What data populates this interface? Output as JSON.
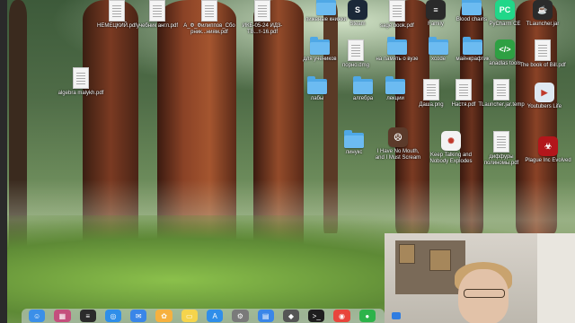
{
  "desktop_icons": [
    {
      "id": "nemetsky",
      "label": "НЕМЕЦКИЙ.pdf",
      "kind": "doc"
    },
    {
      "id": "uchebnik",
      "label": "учебник англ.pdf",
      "kind": "doc"
    },
    {
      "id": "filippov",
      "label": "А_Ф_Филиппов_Сборник...ниям.pdf",
      "kind": "doc"
    },
    {
      "id": "ikb",
      "label": "ИКБ-05-24 ИД3-ТВ...т-16.pdf",
      "kind": "doc"
    },
    {
      "id": "pizh",
      "label": "пиженые книжки",
      "kind": "folder"
    },
    {
      "id": "steam",
      "label": "Steam",
      "kind": "app",
      "color": "#1b2838",
      "glyph": "S"
    },
    {
      "id": "sage",
      "label": "sage book.pdf",
      "kind": "doc"
    },
    {
      "id": "family",
      "label": "Family",
      "kind": "app",
      "color": "#2a2a2a",
      "glyph": "≡"
    },
    {
      "id": "blood",
      "label": "Blood chains",
      "kind": "folder"
    },
    {
      "id": "pycharm",
      "label": "PyCharm CE",
      "kind": "app",
      "color": "#21d789",
      "glyph": "PC"
    },
    {
      "id": "tlauncher",
      "label": "TLauncher.jar",
      "kind": "app",
      "color": "#2b2b2b",
      "glyph": "☕"
    },
    {
      "id": "algebra_m",
      "label": "algebra malykh.pdf",
      "kind": "doc"
    },
    {
      "id": "uchenik",
      "label": "для учеников",
      "kind": "folder"
    },
    {
      "id": "porno",
      "label": "порно.dmg",
      "kind": "doc"
    },
    {
      "id": "navuz",
      "label": "на память о вузе",
      "kind": "folder"
    },
    {
      "id": "xcode",
      "label": "xcode",
      "kind": "folder"
    },
    {
      "id": "maynkraftik",
      "label": "майнкрафтик",
      "kind": "folder"
    },
    {
      "id": "anadlas",
      "label": "anadlas tools",
      "kind": "app",
      "color": "#2ea043",
      "glyph": "</>"
    },
    {
      "id": "billbook",
      "label": "The book of Bill.pdf",
      "kind": "doc"
    },
    {
      "id": "laby",
      "label": "лабы",
      "kind": "folder"
    },
    {
      "id": "algebra",
      "label": "алгебра",
      "kind": "folder"
    },
    {
      "id": "lekcii",
      "label": "лекции",
      "kind": "folder"
    },
    {
      "id": "dasha",
      "label": "Даша.png",
      "kind": "doc"
    },
    {
      "id": "nastya",
      "label": "Настя.pdf",
      "kind": "doc"
    },
    {
      "id": "tlauncher_tmp",
      "label": "TLauncher.jar.temp",
      "kind": "doc"
    },
    {
      "id": "youtubers",
      "label": "Youtubers Life",
      "kind": "app",
      "color": "#dfe9f3",
      "glyph": "▶"
    },
    {
      "id": "linus",
      "label": "линукс",
      "kind": "folder"
    },
    {
      "id": "ihnm",
      "label": "I Have No Mouth, and I Must Scream",
      "kind": "app",
      "color": "#5b3a2a",
      "glyph": "☹"
    },
    {
      "id": "ktne",
      "label": "Keep Talking and Nobody Explodes",
      "kind": "app",
      "color": "#f3f3f3",
      "glyph": "✺"
    },
    {
      "id": "diffury",
      "label": "диффуры полиномы.pdf",
      "kind": "doc"
    },
    {
      "id": "plague",
      "label": "Plague Inc Evolved",
      "kind": "app",
      "color": "#b3161b",
      "glyph": "☣"
    }
  ],
  "dock": [
    {
      "name": "finder",
      "glyph": "☺",
      "color": "#3b8fe8"
    },
    {
      "name": "launchpad",
      "glyph": "▦",
      "color": "#c44f7d"
    },
    {
      "name": "mission-control",
      "glyph": "≡",
      "color": "#2b2b2b"
    },
    {
      "name": "safari",
      "glyph": "◎",
      "color": "#2f8ee9"
    },
    {
      "name": "mail",
      "glyph": "✉",
      "color": "#3a86e8"
    },
    {
      "name": "photos",
      "glyph": "✿",
      "color": "#f6b13f"
    },
    {
      "name": "notes",
      "glyph": "▭",
      "color": "#f5d44c"
    },
    {
      "name": "app-store",
      "glyph": "A",
      "color": "#2f8ee9"
    },
    {
      "name": "system-settings",
      "glyph": "⚙",
      "color": "#7a7a7a"
    },
    {
      "name": "keynote",
      "glyph": "▤",
      "color": "#3a86e8"
    },
    {
      "name": "launcher",
      "glyph": "◆",
      "color": "#555555"
    },
    {
      "name": "terminal",
      "glyph": ">_",
      "color": "#1e1e1e"
    },
    {
      "name": "chrome",
      "glyph": "◉",
      "color": "#e8453c"
    },
    {
      "name": "facetime",
      "glyph": "●",
      "color": "#2db34a"
    }
  ]
}
